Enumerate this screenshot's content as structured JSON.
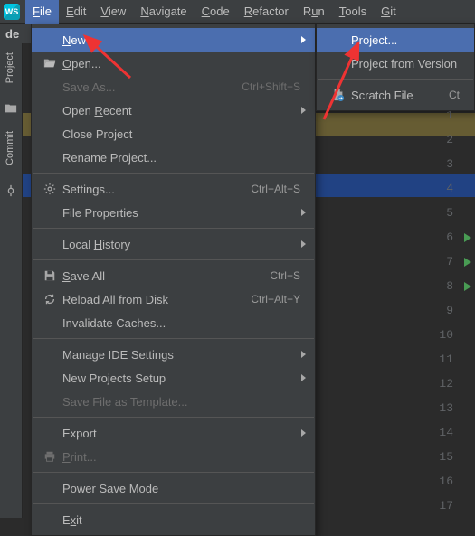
{
  "menubar": {
    "items": [
      {
        "label": "File",
        "mn": "F"
      },
      {
        "label": "Edit",
        "mn": "E"
      },
      {
        "label": "View",
        "mn": "V"
      },
      {
        "label": "Navigate",
        "mn": "N"
      },
      {
        "label": "Code",
        "mn": "C"
      },
      {
        "label": "Refactor",
        "mn": "R"
      },
      {
        "label": "Run",
        "mn": "u"
      },
      {
        "label": "Tools",
        "mn": "T"
      },
      {
        "label": "Git",
        "mn": "G"
      }
    ]
  },
  "tabbar": {
    "label": "de"
  },
  "tool_strip": {
    "project": "Project",
    "commit": "Commit"
  },
  "file_menu": {
    "new": {
      "label": "New",
      "mn": "N"
    },
    "open": {
      "label": "Open...",
      "mn": "O"
    },
    "save_as": {
      "label": "Save As...",
      "shortcut": "Ctrl+Shift+S"
    },
    "open_recent": {
      "label": "Open Recent",
      "mn": "R"
    },
    "close_project": {
      "label": "Close Project"
    },
    "rename_project": {
      "label": "Rename Project..."
    },
    "settings": {
      "label": "Settings...",
      "shortcut": "Ctrl+Alt+S"
    },
    "file_properties": {
      "label": "File Properties"
    },
    "local_history": {
      "label": "Local History",
      "mn": "H"
    },
    "save_all": {
      "label": "Save All",
      "mn": "S",
      "shortcut": "Ctrl+S"
    },
    "reload": {
      "label": "Reload All from Disk",
      "shortcut": "Ctrl+Alt+Y"
    },
    "invalidate": {
      "label": "Invalidate Caches..."
    },
    "manage_ide": {
      "label": "Manage IDE Settings"
    },
    "new_projects_setup": {
      "label": "New Projects Setup"
    },
    "save_template": {
      "label": "Save File as Template..."
    },
    "export": {
      "label": "Export"
    },
    "print": {
      "label": "Print...",
      "mn": "P"
    },
    "power_save": {
      "label": "Power Save Mode"
    },
    "exit": {
      "label": "Exit",
      "mn": "x"
    }
  },
  "new_menu": {
    "project": {
      "label": "Project..."
    },
    "from_vcs": {
      "label": "Project from Version"
    },
    "scratch": {
      "label": "Scratch File",
      "shortcut": "Ct"
    }
  },
  "gutter": {
    "lines": [
      1,
      2,
      3,
      4,
      5,
      6,
      7,
      8,
      9,
      10,
      11,
      12,
      13,
      14,
      15,
      16,
      17
    ],
    "run_markers": [
      6,
      7,
      8
    ]
  }
}
